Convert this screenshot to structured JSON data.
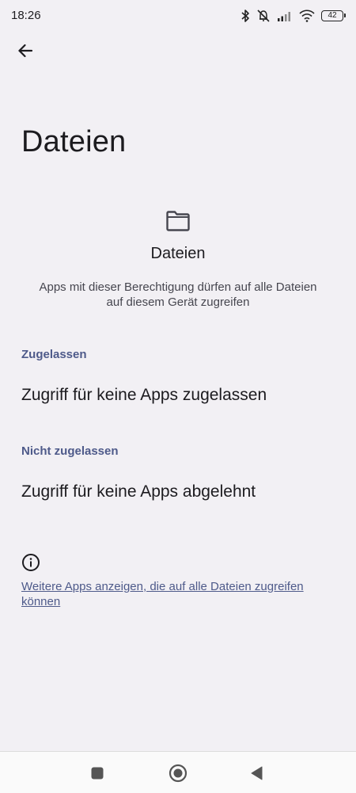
{
  "status_bar": {
    "time": "18:26",
    "battery_level": "42",
    "icons": [
      "bluetooth-icon",
      "muted-bell-icon",
      "signal-icon",
      "wifi-icon",
      "battery-icon"
    ]
  },
  "header": {
    "back_icon": "arrow-left-icon",
    "title": "Dateien"
  },
  "permission": {
    "icon": "folder-icon",
    "heading": "Dateien",
    "description": "Apps mit dieser Berechtigung dürfen auf alle Dateien auf diesem Gerät zugreifen"
  },
  "sections": {
    "allowed": {
      "label": "Zugelassen",
      "item": "Zugriff für keine Apps zugelassen"
    },
    "denied": {
      "label": "Nicht zugelassen",
      "item": "Zugriff für keine Apps abgelehnt"
    }
  },
  "info": {
    "icon": "info-icon",
    "link_text": "Weitere Apps anzeigen, die auf alle Dateien zugreifen können"
  },
  "nav_bar": {
    "buttons": [
      "recents-square-icon",
      "home-circle-icon",
      "back-triangle-icon"
    ]
  },
  "colors": {
    "background": "#f2f0f4",
    "accent": "#4e5a8a",
    "text": "#1c1b1f"
  }
}
